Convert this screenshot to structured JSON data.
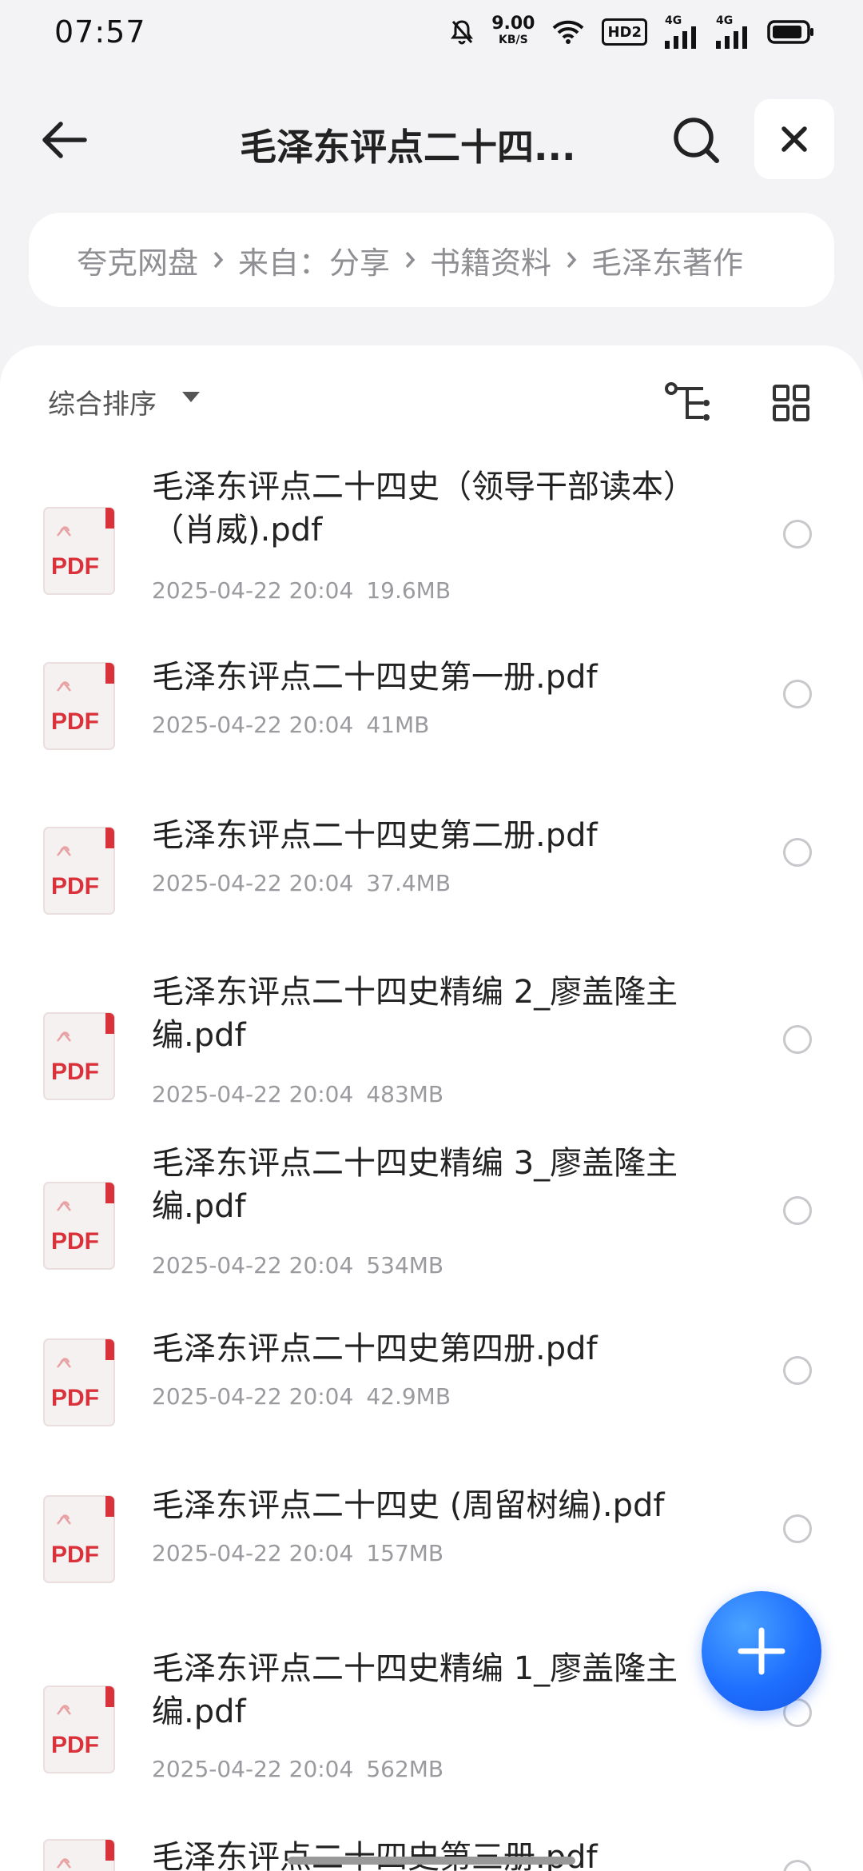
{
  "status_bar": {
    "time": "07:57",
    "net_speed_value": "9.00",
    "net_speed_unit": "KB/S",
    "hd_label": "HD2",
    "sim1_label": "4G",
    "sim2_label": "4G",
    "icons": [
      "mute-bell-icon",
      "wifi-icon",
      "signal-icon",
      "battery-icon"
    ]
  },
  "header": {
    "title": "毛泽东评点二十四...",
    "back_icon": "arrow-left-icon",
    "search_icon": "search-icon",
    "close_icon": "close-icon"
  },
  "breadcrumb": {
    "items": [
      "夸克网盘",
      "来自：分享",
      "书籍资料",
      "毛泽东著作"
    ]
  },
  "toolbar": {
    "sort_label": "综合排序",
    "tree_icon": "folder-tree-icon",
    "grid_icon": "grid-view-icon"
  },
  "files": [
    {
      "name": "毛泽东评点二十四史（领导干部读本）（肖威).pdf",
      "date": "2025-04-22 20:04",
      "size": "19.6MB"
    },
    {
      "name": "毛泽东评点二十四史第一册.pdf",
      "date": "2025-04-22 20:04",
      "size": "41MB"
    },
    {
      "name": "毛泽东评点二十四史第二册.pdf",
      "date": "2025-04-22 20:04",
      "size": "37.4MB"
    },
    {
      "name": "毛泽东评点二十四史精编 2_廖盖隆主编.pdf",
      "date": "2025-04-22 20:04",
      "size": "483MB"
    },
    {
      "name": "毛泽东评点二十四史精编 3_廖盖隆主编.pdf",
      "date": "2025-04-22 20:04",
      "size": "534MB"
    },
    {
      "name": "毛泽东评点二十四史第四册.pdf",
      "date": "2025-04-22 20:04",
      "size": "42.9MB"
    },
    {
      "name": "毛泽东评点二十四史 (周留树编).pdf",
      "date": "2025-04-22 20:04",
      "size": "157MB"
    },
    {
      "name": "毛泽东评点二十四史精编 1_廖盖隆主编.pdf",
      "date": "2025-04-22 20:04",
      "size": "562MB"
    },
    {
      "name": "毛泽东评点二十四史第三册.pdf",
      "date": "",
      "size": ""
    }
  ],
  "file_icon_label": "PDF",
  "fab": {
    "icon": "plus-icon"
  },
  "colors": {
    "accent": "#1f6fff",
    "pdf_red": "#d9323a",
    "background": "#f3f3f5"
  }
}
